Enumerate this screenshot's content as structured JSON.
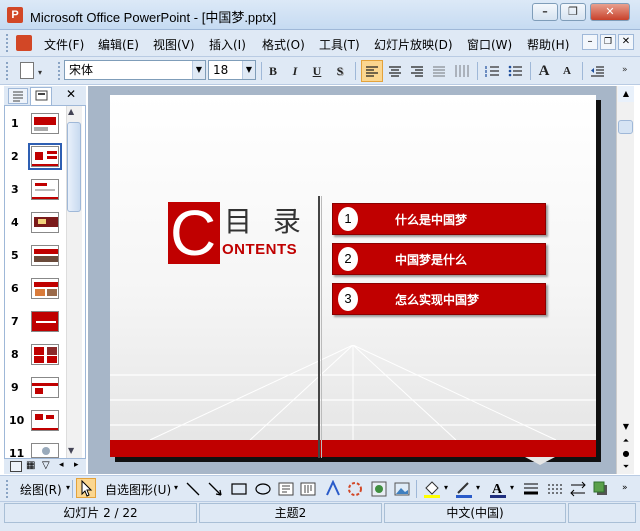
{
  "window": {
    "title": "Microsoft Office PowerPoint - [中国梦.pptx]",
    "app_icon": "P"
  },
  "window_controls": {
    "minimize": "–",
    "restore": "❐",
    "close": "✕"
  },
  "menu": [
    "文件(F)",
    "编辑(E)",
    "视图(V)",
    "插入(I)",
    "格式(O)",
    "工具(T)",
    "幻灯片放映(D)",
    "窗口(W)",
    "帮助(H)"
  ],
  "toolbar": {
    "font_name": "宋体",
    "font_size": "18",
    "bold": "B",
    "italic": "I",
    "underline": "U",
    "shadow": "S",
    "grow_font": "A",
    "shrink_font": "A"
  },
  "slides_pane": {
    "slide_numbers": [
      "1",
      "2",
      "3",
      "4",
      "5",
      "6",
      "7",
      "8",
      "9",
      "10",
      "11"
    ],
    "selected": "2"
  },
  "slide": {
    "big_letter": "C",
    "heading": "目 录",
    "subheading": "ONTENTS",
    "items": [
      {
        "num": "1",
        "text": "什么是中国梦"
      },
      {
        "num": "2",
        "text": "中国梦是什么"
      },
      {
        "num": "3",
        "text": "怎么实现中国梦"
      }
    ],
    "accent_color": "#c00000"
  },
  "drawbar": {
    "draw_label": "绘图(R)",
    "autoshape_label": "自选图形(U)"
  },
  "status": {
    "slide": "幻灯片 2 / 22",
    "theme": "主题2",
    "language": "中文(中国)"
  }
}
